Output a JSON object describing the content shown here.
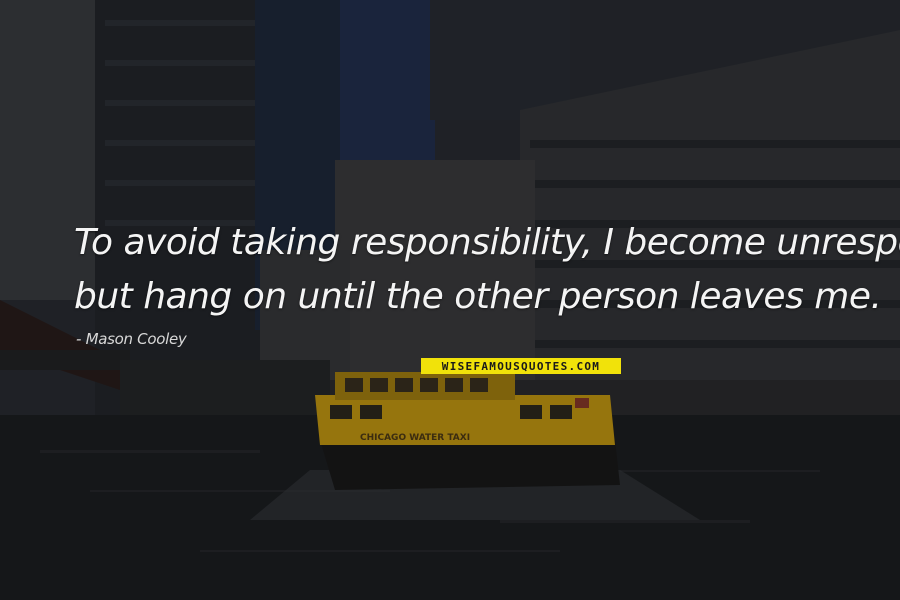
{
  "quote": {
    "lines": [
      "To avoid taking responsibility, I become unresponsive",
      "but hang on until the other person leaves me."
    ],
    "author": "- Mason Cooley"
  },
  "watermark": {
    "text": "WISEFAMOUSQUOTES.COM",
    "color": "#f1e20a"
  },
  "boat": {
    "text": "CHICAGO WATER TAXI",
    "color": "#e8b80e"
  }
}
